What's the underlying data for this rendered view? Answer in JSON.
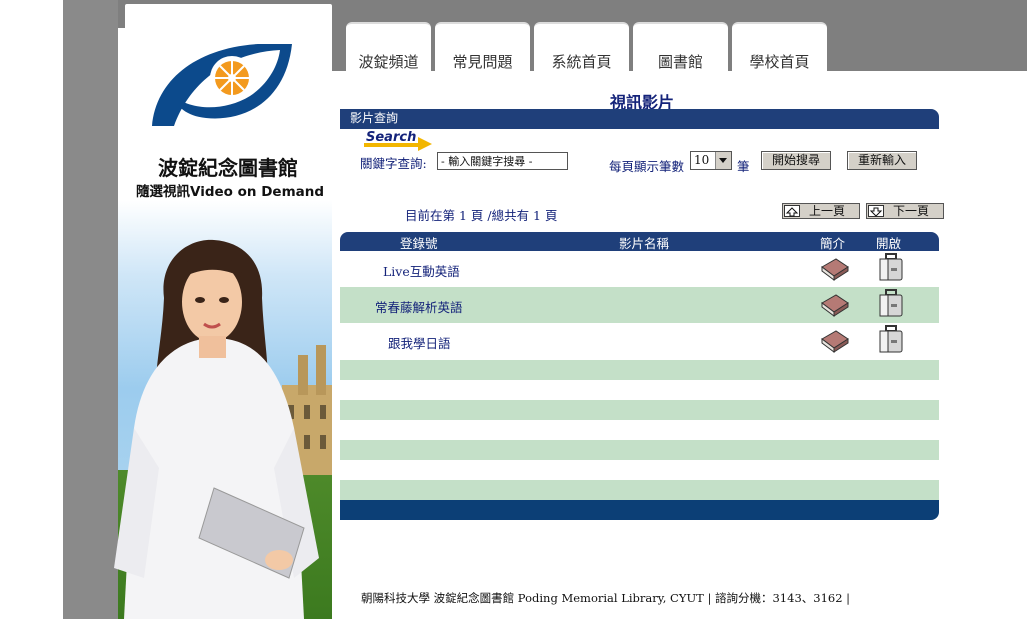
{
  "library": {
    "title": "波錠紀念圖書館",
    "subtitle": "隨選視訊Video on Demand"
  },
  "nav": {
    "tabs": [
      {
        "label": "波錠頻道"
      },
      {
        "label": "常見問題"
      },
      {
        "label": "系統首頁"
      },
      {
        "label": "圖書館"
      },
      {
        "label": "學校首頁"
      }
    ]
  },
  "page": {
    "title": "視訊影片"
  },
  "search": {
    "section_label": "影片查詢",
    "logo_text": "Search",
    "keyword_label": "關鍵字查詢:",
    "keyword_value": "- 輸入關鍵字搜尋 -",
    "per_page_label": "每頁顯示筆數",
    "per_page_value": "10",
    "per_page_unit": "筆",
    "start_button": "開始搜尋",
    "reset_button": "重新輸入"
  },
  "pagination": {
    "info": "目前在第 1 頁 /總共有 1 頁",
    "prev_label": "上一頁",
    "next_label": "下一頁"
  },
  "table": {
    "headers": {
      "id": "登錄號",
      "name": "影片名稱",
      "intro": "簡介",
      "open": "開啟"
    },
    "rows": [
      {
        "name": "Live互動英語"
      },
      {
        "name": "常春藤解析英語"
      },
      {
        "name": "跟我學日語"
      }
    ]
  },
  "footer": {
    "text": "朝陽科技大學 波錠紀念圖書館 Poding Memorial Library, CYUT | 諮詢分機：3143、3162 |"
  },
  "colors": {
    "header_blue": "#1f3f7a",
    "row_green": "#c4e0c8",
    "footer_blue": "#0c3f76"
  }
}
